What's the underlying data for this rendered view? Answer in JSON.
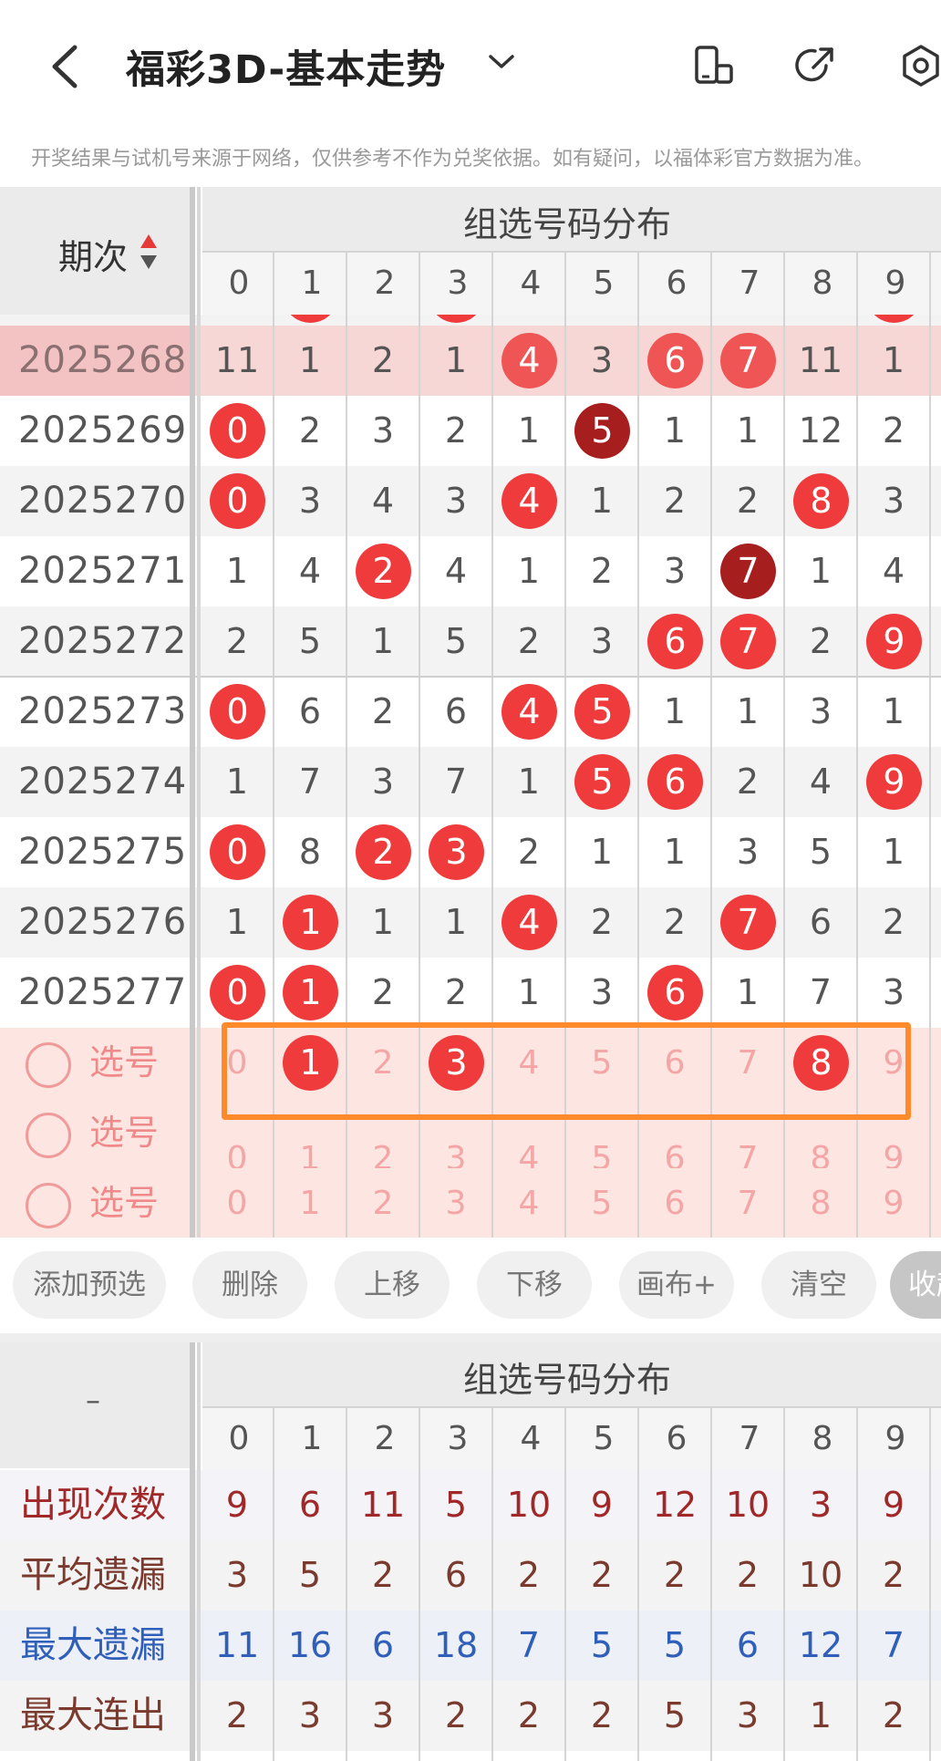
{
  "header": {
    "title": "福彩3D-基本走势",
    "notice": "开奖结果与试机号来源于网络，仅供参考不作为兑奖依据。如有疑问，以福体彩官方数据为准。"
  },
  "main": {
    "period_label": "期次",
    "group_title": "组选号码分布",
    "digits": [
      "0",
      "1",
      "2",
      "3",
      "4",
      "5",
      "6",
      "7",
      "8",
      "9"
    ],
    "rows": [
      {
        "period": "2025268",
        "highlight": true,
        "cells": [
          {
            "v": "11"
          },
          {
            "v": "1"
          },
          {
            "v": "2"
          },
          {
            "v": "1"
          },
          {
            "v": "4",
            "ball": "soft"
          },
          {
            "v": "3"
          },
          {
            "v": "6",
            "ball": "soft"
          },
          {
            "v": "7",
            "ball": "soft"
          },
          {
            "v": "11"
          },
          {
            "v": "1"
          }
        ]
      },
      {
        "period": "2025269",
        "cells": [
          {
            "v": "0",
            "ball": "red"
          },
          {
            "v": "2"
          },
          {
            "v": "3"
          },
          {
            "v": "2"
          },
          {
            "v": "1"
          },
          {
            "v": "5",
            "ball": "dark"
          },
          {
            "v": "1"
          },
          {
            "v": "1"
          },
          {
            "v": "12"
          },
          {
            "v": "2"
          }
        ]
      },
      {
        "period": "2025270",
        "cells": [
          {
            "v": "0",
            "ball": "red"
          },
          {
            "v": "3"
          },
          {
            "v": "4"
          },
          {
            "v": "3"
          },
          {
            "v": "4",
            "ball": "red"
          },
          {
            "v": "1"
          },
          {
            "v": "2"
          },
          {
            "v": "2"
          },
          {
            "v": "8",
            "ball": "red"
          },
          {
            "v": "3"
          }
        ]
      },
      {
        "period": "2025271",
        "cells": [
          {
            "v": "1"
          },
          {
            "v": "4"
          },
          {
            "v": "2",
            "ball": "red"
          },
          {
            "v": "4"
          },
          {
            "v": "1"
          },
          {
            "v": "2"
          },
          {
            "v": "3"
          },
          {
            "v": "7",
            "ball": "dark"
          },
          {
            "v": "1"
          },
          {
            "v": "4"
          }
        ]
      },
      {
        "period": "2025272",
        "cells": [
          {
            "v": "2"
          },
          {
            "v": "5"
          },
          {
            "v": "1"
          },
          {
            "v": "5"
          },
          {
            "v": "2"
          },
          {
            "v": "3"
          },
          {
            "v": "6",
            "ball": "red"
          },
          {
            "v": "7",
            "ball": "red"
          },
          {
            "v": "2"
          },
          {
            "v": "9",
            "ball": "red"
          }
        ]
      },
      {
        "period": "2025273",
        "cells": [
          {
            "v": "0",
            "ball": "red"
          },
          {
            "v": "6"
          },
          {
            "v": "2"
          },
          {
            "v": "6"
          },
          {
            "v": "4",
            "ball": "red"
          },
          {
            "v": "5",
            "ball": "red"
          },
          {
            "v": "1"
          },
          {
            "v": "1"
          },
          {
            "v": "3"
          },
          {
            "v": "1"
          }
        ]
      },
      {
        "period": "2025274",
        "cells": [
          {
            "v": "1"
          },
          {
            "v": "7"
          },
          {
            "v": "3"
          },
          {
            "v": "7"
          },
          {
            "v": "1"
          },
          {
            "v": "5",
            "ball": "red"
          },
          {
            "v": "6",
            "ball": "red"
          },
          {
            "v": "2"
          },
          {
            "v": "4"
          },
          {
            "v": "9",
            "ball": "red"
          }
        ]
      },
      {
        "period": "2025275",
        "cells": [
          {
            "v": "0",
            "ball": "red"
          },
          {
            "v": "8"
          },
          {
            "v": "2",
            "ball": "red"
          },
          {
            "v": "3",
            "ball": "red"
          },
          {
            "v": "2"
          },
          {
            "v": "1"
          },
          {
            "v": "1"
          },
          {
            "v": "3"
          },
          {
            "v": "5"
          },
          {
            "v": "1"
          }
        ]
      },
      {
        "period": "2025276",
        "cells": [
          {
            "v": "1"
          },
          {
            "v": "1",
            "ball": "red"
          },
          {
            "v": "1"
          },
          {
            "v": "1"
          },
          {
            "v": "4",
            "ball": "red"
          },
          {
            "v": "2"
          },
          {
            "v": "2"
          },
          {
            "v": "7",
            "ball": "red"
          },
          {
            "v": "6"
          },
          {
            "v": "2"
          }
        ]
      },
      {
        "period": "2025277",
        "cells": [
          {
            "v": "0",
            "ball": "red"
          },
          {
            "v": "1",
            "ball": "red"
          },
          {
            "v": "2"
          },
          {
            "v": "2"
          },
          {
            "v": "1"
          },
          {
            "v": "3"
          },
          {
            "v": "6",
            "ball": "red"
          },
          {
            "v": "1"
          },
          {
            "v": "7"
          },
          {
            "v": "3"
          }
        ]
      }
    ],
    "select_rows": [
      {
        "label": "选号",
        "selected": [
          "1",
          "3",
          "8"
        ]
      },
      {
        "label": "选号",
        "selected": []
      },
      {
        "label": "选号",
        "selected": []
      }
    ]
  },
  "buttons": [
    "添加预选",
    "删除",
    "上移",
    "下移",
    "画布+",
    "清空"
  ],
  "collapse_label": "收起",
  "stats": {
    "corner": "–",
    "group_title": "组选号码分布",
    "rows": [
      {
        "label": "出现次数",
        "color": "#a02828",
        "values": [
          "9",
          "6",
          "11",
          "5",
          "10",
          "9",
          "12",
          "10",
          "3",
          "9"
        ]
      },
      {
        "label": "平均遗漏",
        "color": "#7a3a2e",
        "values": [
          "3",
          "5",
          "2",
          "6",
          "2",
          "2",
          "2",
          "2",
          "10",
          "2"
        ]
      },
      {
        "label": "最大遗漏",
        "color": "#2f5fb8",
        "values": [
          "11",
          "16",
          "6",
          "18",
          "7",
          "5",
          "5",
          "6",
          "12",
          "7"
        ]
      },
      {
        "label": "最大连出",
        "color": "#7a3a2e",
        "values": [
          "2",
          "3",
          "3",
          "2",
          "2",
          "2",
          "5",
          "3",
          "1",
          "2"
        ]
      }
    ]
  }
}
